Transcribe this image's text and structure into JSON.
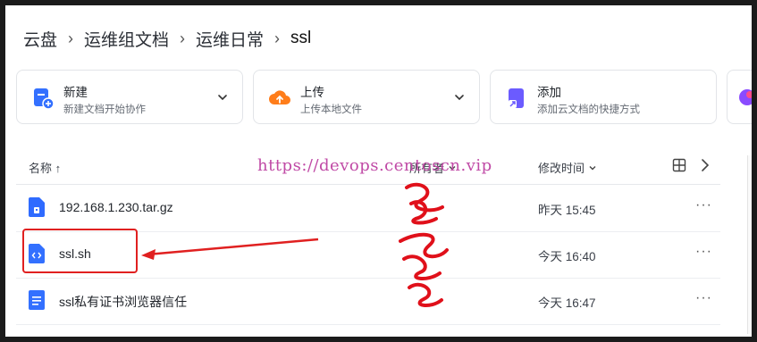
{
  "breadcrumb": {
    "items": [
      "云盘",
      "运维组文档",
      "运维日常",
      "ssl"
    ],
    "separator": "›"
  },
  "cards": [
    {
      "title": "新建",
      "subtitle": "新建文档开始协作",
      "icon": "new-doc-icon",
      "has_dropdown": true
    },
    {
      "title": "上传",
      "subtitle": "上传本地文件",
      "icon": "cloud-upload-icon",
      "has_dropdown": true
    },
    {
      "title": "添加",
      "subtitle": "添加云文档的快捷方式",
      "icon": "add-shortcut-icon",
      "has_dropdown": false
    }
  ],
  "list": {
    "columns": {
      "name": "名称 ↑",
      "owner": "所有者",
      "modified": "修改时间"
    },
    "files": [
      {
        "name": "192.168.1.230.tar.gz",
        "modified": "昨天 15:45",
        "icon": "archive-file-icon",
        "color": "#2f6bff"
      },
      {
        "name": "ssl.sh",
        "modified": "今天 16:40",
        "icon": "code-file-icon",
        "color": "#3370ff"
      },
      {
        "name": "ssl私有证书浏览器信任",
        "modified": "今天 16:47",
        "icon": "doc-file-icon",
        "color": "#3370ff"
      }
    ],
    "more_label": "···"
  },
  "watermark": "https://devops.centoscn.vip",
  "colors": {
    "accent": "#3370ff",
    "annotation_red": "#e02020",
    "watermark": "#c04aa6",
    "upload_orange": "#ff7d1a"
  }
}
